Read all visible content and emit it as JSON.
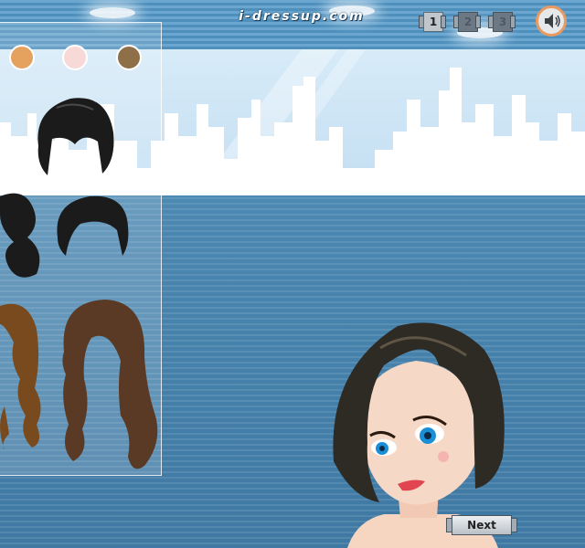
{
  "header": {
    "logo_text": "i-dressup.com"
  },
  "pager": {
    "pages": [
      {
        "label": "1",
        "active": true
      },
      {
        "label": "2",
        "active": false
      },
      {
        "label": "3",
        "active": false
      }
    ]
  },
  "sound": {
    "icon": "speaker-icon"
  },
  "hair_colors": [
    {
      "name": "caramel",
      "color": "#e5a15e"
    },
    {
      "name": "pink",
      "color": "#f7d9d8"
    },
    {
      "name": "brown",
      "color": "#8f6f47"
    }
  ],
  "hair_styles": [
    {
      "name": "black-bob-bangs",
      "color": "#1b1b1b"
    },
    {
      "name": "black-side-bun",
      "color": "#1b1b1b"
    },
    {
      "name": "black-short",
      "color": "#1b1b1b"
    },
    {
      "name": "brown-wavy-partial",
      "color": "#7a4a1f"
    },
    {
      "name": "brown-long-wavy",
      "color": "#5a3a24"
    }
  ],
  "actions": {
    "next_label": "Next"
  },
  "colors": {
    "accent": "#e89a60",
    "background": "#4b87b1"
  }
}
